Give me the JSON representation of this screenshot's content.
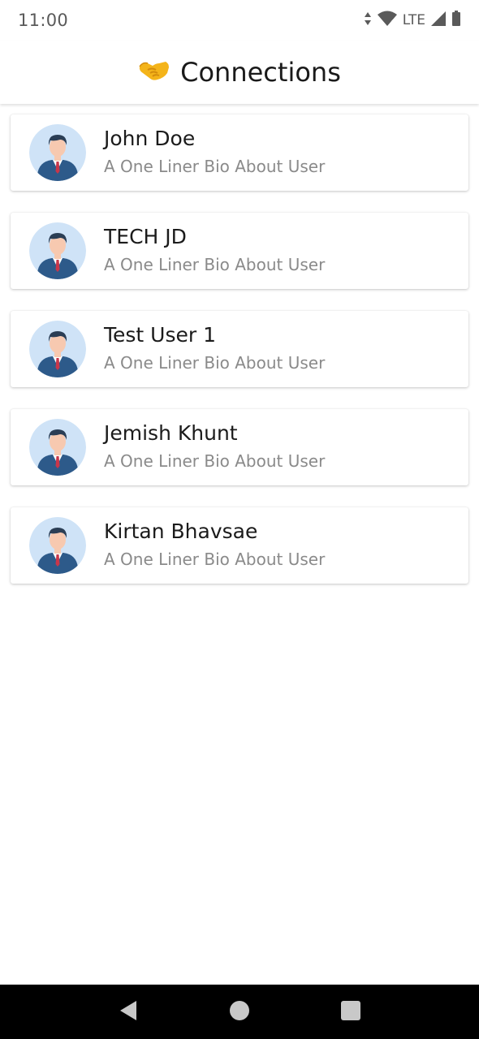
{
  "status_bar": {
    "time": "11:00",
    "network": "LTE",
    "icons": [
      "data-arrows-icon",
      "wifi-icon",
      "signal-icon",
      "battery-icon"
    ]
  },
  "app_bar": {
    "icon": "handshake-icon",
    "title": "Connections"
  },
  "connections": [
    {
      "name": "John Doe",
      "bio": "A One Liner Bio About User"
    },
    {
      "name": "TECH JD",
      "bio": "A One Liner Bio About User"
    },
    {
      "name": "Test User 1",
      "bio": "A One Liner Bio About User"
    },
    {
      "name": "Jemish Khunt",
      "bio": "A One Liner Bio About User"
    },
    {
      "name": "Kirtan Bhavsae",
      "bio": "A One Liner Bio About User"
    }
  ],
  "nav_bar": {
    "buttons": [
      "back-icon",
      "home-icon",
      "recents-icon"
    ]
  },
  "colors": {
    "avatar_bg": "#cfe3f7",
    "suit": "#2d5a8a",
    "hair": "#2b3e55",
    "skin": "#f7c9b0",
    "tie": "#c9364a"
  }
}
